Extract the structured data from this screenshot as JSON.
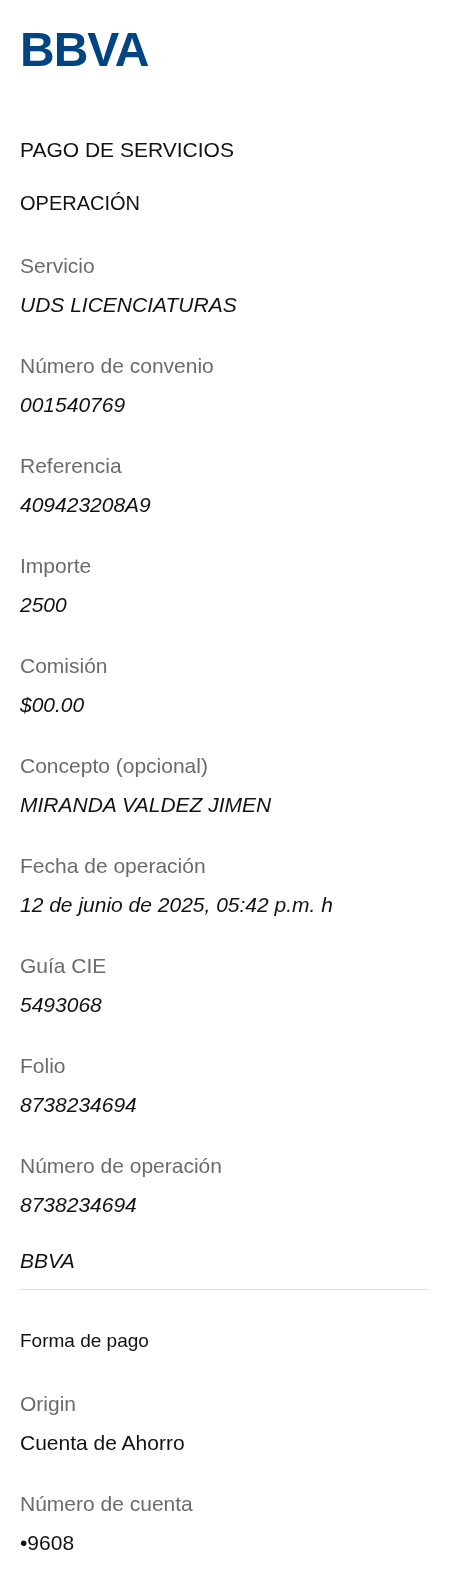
{
  "logo": "BBVA",
  "title": "PAGO DE SERVICIOS",
  "section": "OPERACIÓN",
  "fields": [
    {
      "label": "Servicio",
      "value": "UDS LICENCIATURAS"
    },
    {
      "label": "Número de convenio",
      "value": "001540769"
    },
    {
      "label": "Referencia",
      "value": "409423208A9"
    },
    {
      "label": "Importe",
      "value": "2500"
    },
    {
      "label": "Comisión",
      "value": "$00.00"
    },
    {
      "label": "Concepto (opcional)",
      "value": "MIRANDA VALDEZ JIMEN"
    },
    {
      "label": "Fecha de operación",
      "value": "12 de junio de 2025, 05:42 p.m. h"
    },
    {
      "label": "Guía CIE",
      "value": "5493068"
    },
    {
      "label": "Folio",
      "value": "8738234694"
    },
    {
      "label": "Número de operación",
      "value": "8738234694"
    }
  ],
  "bank": "BBVA",
  "payment": {
    "title": "Forma de pago",
    "fields": [
      {
        "label": "Origin",
        "value": "Cuenta de Ahorro"
      },
      {
        "label": "Número de cuenta",
        "value": "•9608"
      }
    ]
  }
}
